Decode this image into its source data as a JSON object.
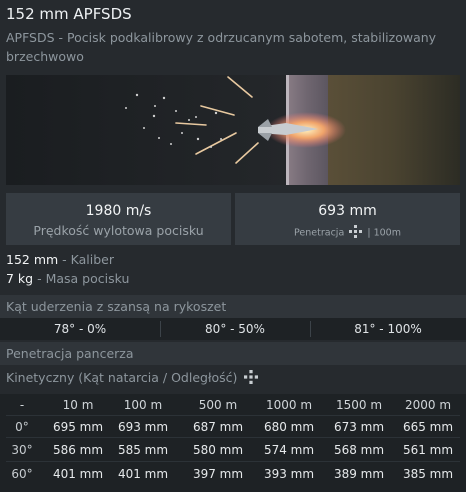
{
  "shell": {
    "title": "152 mm APFSDS",
    "description_abbr": "APFSDS",
    "description_rest": " - Pocisk podkalibrowy z odrzucanym sabotem, stabilizowany brzechwowo"
  },
  "stats": {
    "velocity_value": "1980 m/s",
    "velocity_label": "Prędkość wylotowa pocisku",
    "penetration_value": "693 mm",
    "penetration_label": "Penetracja",
    "penetration_distance": "| 100m"
  },
  "specs": [
    {
      "value": "152 mm",
      "label": " - Kaliber"
    },
    {
      "value": "7 kg",
      "label": " - Masa pocisku"
    }
  ],
  "ricochet": {
    "header": "Kąt uderzenia z szansą na rykoszet",
    "cells": [
      "78° - 0%",
      "80° - 50%",
      "81° - 100%"
    ]
  },
  "armor": {
    "header": "Penetracja pancerza",
    "kinetic_label": "Kinetyczny (Kąt natarcia / Odległość)",
    "columns": [
      "-",
      "10 m",
      "100 m",
      "500 m",
      "1000 m",
      "1500 m",
      "2000 m"
    ],
    "rows": [
      {
        "angle": "0°",
        "values": [
          "695 mm",
          "693 mm",
          "687 mm",
          "680 mm",
          "673 mm",
          "665 mm"
        ]
      },
      {
        "angle": "30°",
        "values": [
          "586 mm",
          "585 mm",
          "580 mm",
          "574 mm",
          "568 mm",
          "561 mm"
        ]
      },
      {
        "angle": "60°",
        "values": [
          "401 mm",
          "401 mm",
          "397 mm",
          "393 mm",
          "389 mm",
          "385 mm"
        ]
      }
    ]
  },
  "colors": {
    "background": "#262a2e",
    "panel": "#363c42",
    "table": "#1e2225",
    "section_header": "#30353a"
  },
  "icons": {
    "penetration": "crosshair-target-icon",
    "kinetic": "crosshair-target-icon"
  }
}
